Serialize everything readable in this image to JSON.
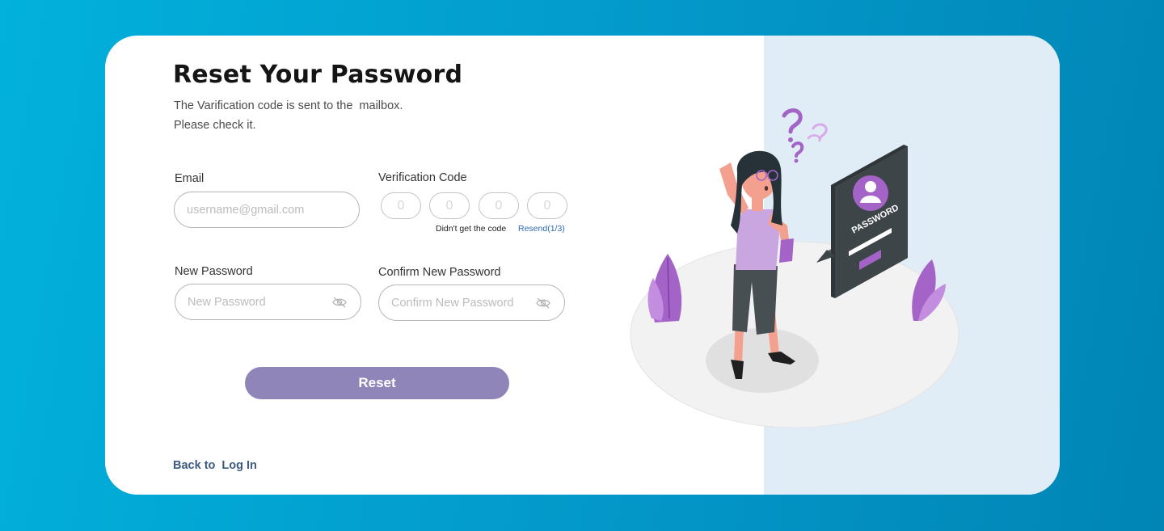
{
  "header": {
    "title": "Reset Your Password",
    "subtitle_line1": "The Varification code is sent to the  mailbox.",
    "subtitle_line2": "Please check it."
  },
  "email": {
    "label": "Email",
    "placeholder": "username@gmail.com",
    "value": ""
  },
  "verification": {
    "label": "Verification Code",
    "digits": [
      "0",
      "0",
      "0",
      "0"
    ],
    "hint": "Didn't get the code",
    "resend_label": "Resend(1/3)"
  },
  "new_password": {
    "label": "New Password",
    "placeholder": "New Password",
    "icon": "eye-off-icon"
  },
  "confirm_password": {
    "label": "Confirm New Password",
    "placeholder": "Confirm New Password",
    "icon": "eye-off-icon"
  },
  "actions": {
    "reset_label": "Reset"
  },
  "footer": {
    "back_text": "Back to",
    "login_link": "Log In"
  },
  "illustration": {
    "panel_text": "PASSWORD",
    "accent_color": "#a463c7"
  },
  "colors": {
    "background": "#02a6d3",
    "button": "#9085b8",
    "link": "#2d6ab5",
    "footer_link": "#3d5a80",
    "panel": "#e1edf6"
  }
}
